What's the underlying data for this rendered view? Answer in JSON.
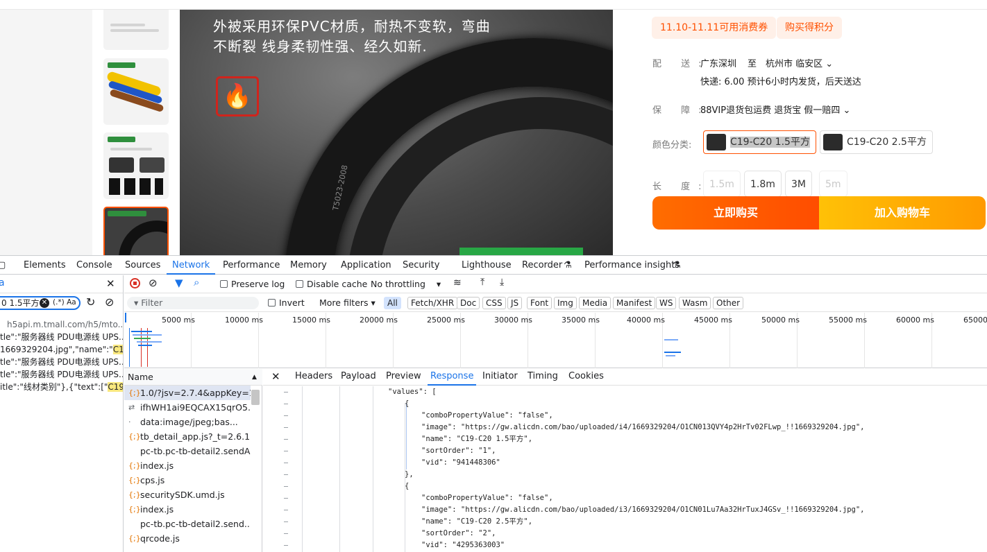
{
  "product": {
    "captions": [
      "外被采用环保PVC材质，耐热不变软，弯曲",
      "不断裂 线身柔韧性强、经久如新."
    ],
    "cable_marking": "T5023-2008",
    "coupon": "11.10-11.11可用消费券",
    "points": "购买得积分",
    "shipping_label": "配 送:",
    "shipping_from": "广东深圳",
    "shipping_to_word": "至",
    "shipping_dest": "杭州市 临安区",
    "delivery": "快递: 6.00  预计6小时内发货，后天送达",
    "guarantee_label": "保 障:",
    "guarantee": "88VIP退货包运费 退货宝 假一赔四",
    "color_label": "颜色分类:",
    "colors": [
      "C19-C20 1.5平方",
      "C19-C20 2.5平方"
    ],
    "length_label": "长 度:",
    "lengths": [
      "1.5m",
      "1.8m",
      "3M",
      "5m"
    ],
    "buy_now": "立即购买",
    "add_cart": "加入购物车"
  },
  "devtools": {
    "tabs": [
      "Elements",
      "Console",
      "Sources",
      "Network",
      "Performance",
      "Memory",
      "Application",
      "Security",
      "Lighthouse",
      "Recorder",
      "Performance insights"
    ],
    "active_tab": "Network",
    "search_query": "0 1.5平方",
    "search_options": "(.*)  Aa",
    "search_results": [
      {
        "pre": "h5api.m.tmall.com/h5/mto...",
        "hl": ""
      },
      {
        "pre": "tle\":\"服务器线 PDU电源线 UPS...",
        "hl": ""
      },
      {
        "pre": "1669329204.jpg\",\"name\":\"",
        "hl": "C1..."
      },
      {
        "pre": "tle\":\"服务器线 PDU电源线 UPS...",
        "hl": ""
      },
      {
        "pre": "tle\":\"服务器线 PDU电源线 UPS...",
        "hl": ""
      },
      {
        "pre": "itle\":\"线材类别\"},{\"text\":[\"",
        "hl": "C19-..."
      }
    ],
    "toolbar": {
      "preserve_log": "Preserve log",
      "disable_cache": "Disable cache",
      "throttling": "No throttling"
    },
    "filter_placeholder": "Filter",
    "invert": "Invert",
    "more_filters": "More filters",
    "type_filters": [
      "All",
      "Fetch/XHR",
      "Doc",
      "CSS",
      "JS",
      "Font",
      "Img",
      "Media",
      "Manifest",
      "WS",
      "Wasm",
      "Other"
    ],
    "timeline_ticks": [
      "5000 ms",
      "10000 ms",
      "15000 ms",
      "20000 ms",
      "25000 ms",
      "30000 ms",
      "35000 ms",
      "40000 ms",
      "45000 ms",
      "50000 ms",
      "55000 ms",
      "60000 ms",
      "65000 ms"
    ],
    "name_header": "Name",
    "requests": [
      {
        "icon": "{;}",
        "name": "1.0/?jsv=2.7.4&appKey=1..."
      },
      {
        "icon": "⇄",
        "name": "ifhWH1ai9EQCAX15qrO5..."
      },
      {
        "icon": "·",
        "name": "data:image/jpeg;bas..."
      },
      {
        "icon": "{;}",
        "name": "tb_detail_app.js?_t=2.6.1"
      },
      {
        "icon": "",
        "name": "pc-tb.pc-tb-detail2.sendAb"
      },
      {
        "icon": "{;}",
        "name": "index.js"
      },
      {
        "icon": "{;}",
        "name": "cps.js"
      },
      {
        "icon": "{;}",
        "name": "securitySDK.umd.js"
      },
      {
        "icon": "{;}",
        "name": "index.js"
      },
      {
        "icon": "",
        "name": "pc-tb.pc-tb-detail2.send..."
      },
      {
        "icon": "{;}",
        "name": "qrcode.js"
      }
    ],
    "detail_tabs": [
      "Headers",
      "Payload",
      "Preview",
      "Response",
      "Initiator",
      "Timing",
      "Cookies"
    ],
    "active_detail_tab": "Response",
    "response_lines": [
      "\"values\": [",
      "{",
      "\"comboPropertyValue\": \"false\",",
      "\"image\": \"https://gw.alicdn.com/bao/uploaded/i4/1669329204/O1CN013QVY4p2HrTv02FLwp_!!1669329204.jpg\",",
      "\"name\": \"C19-C20 1.5平方\",",
      "\"sortOrder\": \"1\",",
      "\"vid\": \"941448306\"",
      "},",
      "{",
      "\"comboPropertyValue\": \"false\",",
      "\"image\": \"https://gw.alicdn.com/bao/uploaded/i3/1669329204/O1CN01Lu7Aa32HrTuxJ4GSv_!!1669329204.jpg\",",
      "\"name\": \"C19-C20 2.5平方\",",
      "\"sortOrder\": \"2\",",
      "\"vid\": \"4295363003\""
    ]
  }
}
